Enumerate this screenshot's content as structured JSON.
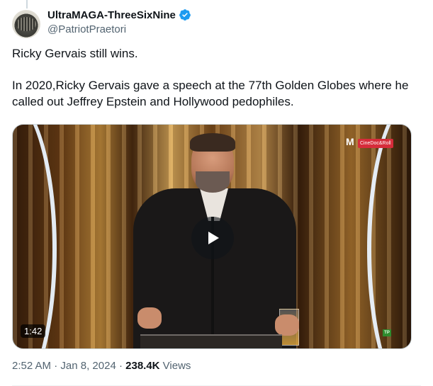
{
  "author": {
    "display_name": "UltraMAGA-ThreeSixNine",
    "handle": "@PatriotPraetori",
    "verified": true,
    "verified_color": "#1d9bf0"
  },
  "tweet": {
    "line1": "Ricky Gervais still wins.",
    "line2": "In 2020,Ricky Gervais gave a speech at the 77th Golden Globes where he called out Jeffrey Epstein and Hollywood pedophiles."
  },
  "media": {
    "duration": "1:42",
    "brand_letter": "M",
    "brand_tag": "CineDoc&Roll",
    "corner_logo": "TP",
    "play_icon": "play-icon"
  },
  "meta": {
    "time": "2:52 AM",
    "separator": " · ",
    "date": "Jan 8, 2024",
    "separator2": " · ",
    "views_count": "238.4K",
    "views_label": " Views"
  }
}
